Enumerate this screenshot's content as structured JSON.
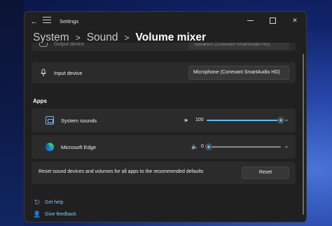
{
  "window": {
    "title": "Settings",
    "minimize_label": "Minimize",
    "maximize_label": "Maximize",
    "close_label": "Close"
  },
  "breadcrumb": {
    "items": [
      "System",
      "Sound",
      "Volume mixer"
    ],
    "separator": ">"
  },
  "output_device": {
    "label": "Output device",
    "value": "Speakers (Conexant SmartAudio HD)"
  },
  "input_device": {
    "label": "Input device",
    "value": "Microphone (Conexant SmartAudio HD)"
  },
  "apps": {
    "section_title": "Apps",
    "items": [
      {
        "name": "System sounds",
        "volume": 100,
        "icon": "system-sounds-icon"
      },
      {
        "name": "Microsoft Edge",
        "volume": 0,
        "icon": "edge-icon"
      }
    ]
  },
  "reset": {
    "text": "Reset sound devices and volumes for all apps to the recommended defaults",
    "button_label": "Reset"
  },
  "links": {
    "get_help": "Get help",
    "give_feedback": "Give feedback"
  },
  "colors": {
    "accent": "#4cc2ff",
    "window_bg": "#202020",
    "card_bg": "#2b2b2b",
    "link": "#7cc7ff"
  }
}
